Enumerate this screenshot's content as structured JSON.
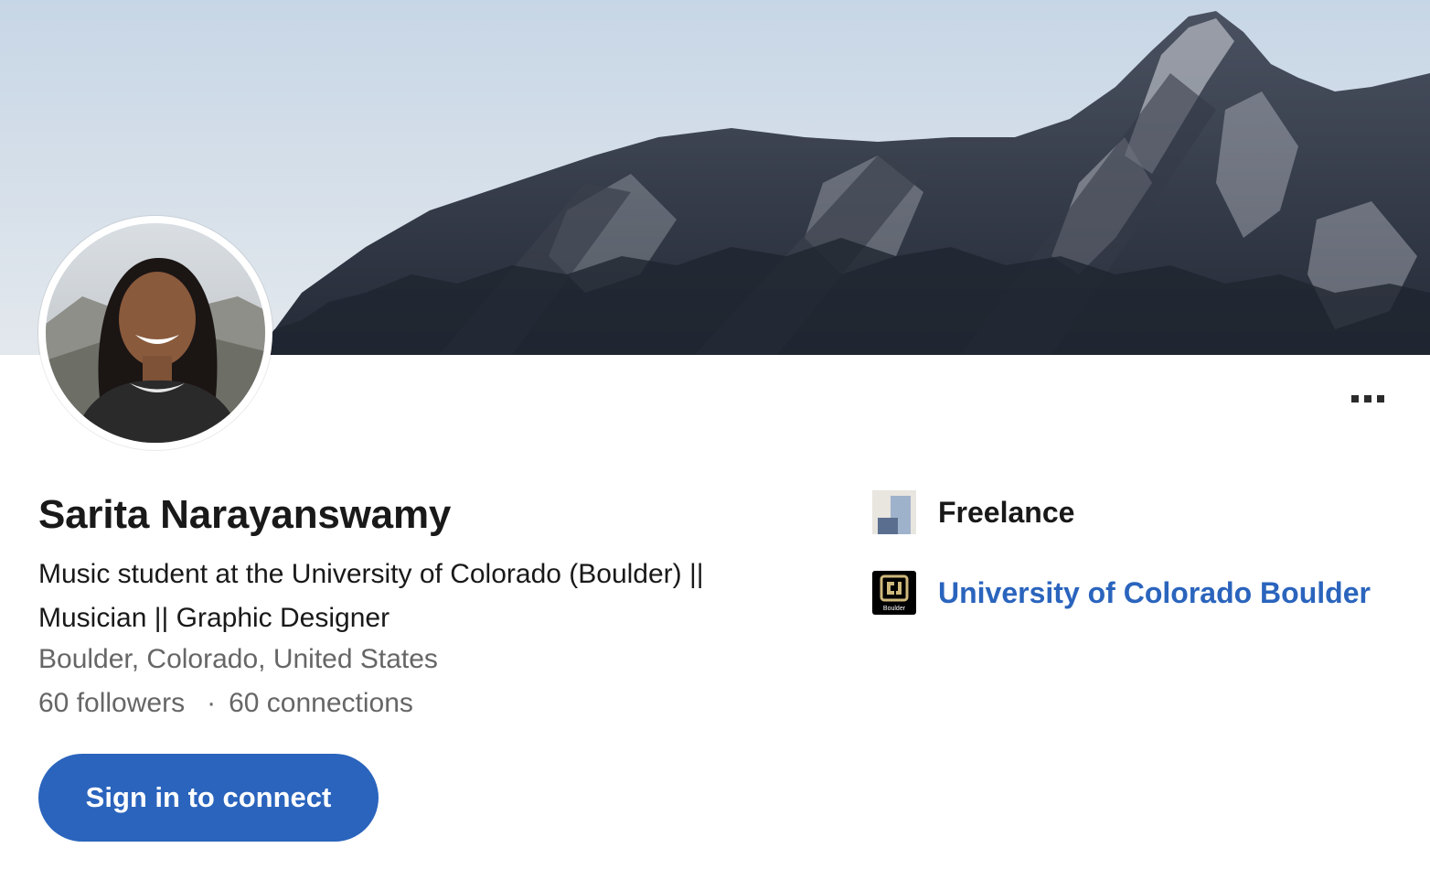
{
  "profile": {
    "name": "Sarita Narayanswamy",
    "headline": "Music student at the University of Colorado (Boulder) || Musician || Graphic Designer",
    "location": "Boulder, Colorado, United States",
    "followers": "60 followers",
    "separator": "·",
    "connections": "60 connections"
  },
  "actions": {
    "signin_label": "Sign in to connect"
  },
  "experience": {
    "current_company": "Freelance",
    "education": "University of Colorado Boulder",
    "education_logo_text": "Boulder"
  },
  "icons": {
    "more": "more-horizontal-icon",
    "freelance_logo": "company-placeholder-logo",
    "university_logo": "cu-boulder-logo"
  },
  "colors": {
    "accent": "#2a64bd",
    "primary_text": "#191919",
    "secondary_text": "#666666"
  }
}
